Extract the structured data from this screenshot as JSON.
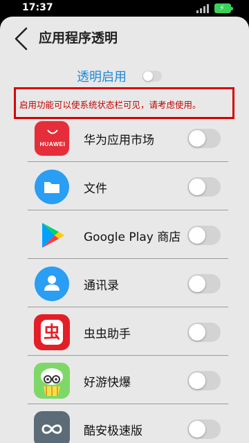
{
  "statusbar": {
    "time": "17:37"
  },
  "header": {
    "title": "应用程序透明"
  },
  "master": {
    "label": "透明启用",
    "enabled": false
  },
  "notice": {
    "text": "启用功能可以使系统状态栏可见，请考虑使用。"
  },
  "apps": [
    {
      "name": "华为应用市场",
      "icon": "huawei-appgallery-icon",
      "icon_text": "HUAWEI",
      "enabled": false
    },
    {
      "name": "文件",
      "icon": "files-icon",
      "enabled": false
    },
    {
      "name": "Google Play 商店",
      "icon": "google-play-icon",
      "enabled": false
    },
    {
      "name": "通讯录",
      "icon": "contacts-icon",
      "enabled": false
    },
    {
      "name": "虫虫助手",
      "icon": "chongchong-icon",
      "icon_text": "虫",
      "enabled": false
    },
    {
      "name": "好游快爆",
      "icon": "haoyou-kuaibao-icon",
      "enabled": false
    },
    {
      "name": "酷安极速版",
      "icon": "coolapk-icon",
      "enabled": false
    }
  ],
  "colors": {
    "accent": "#1e88d6",
    "warning": "#c40000",
    "background": "#e8e8e8",
    "battery": "#3ad15b"
  }
}
